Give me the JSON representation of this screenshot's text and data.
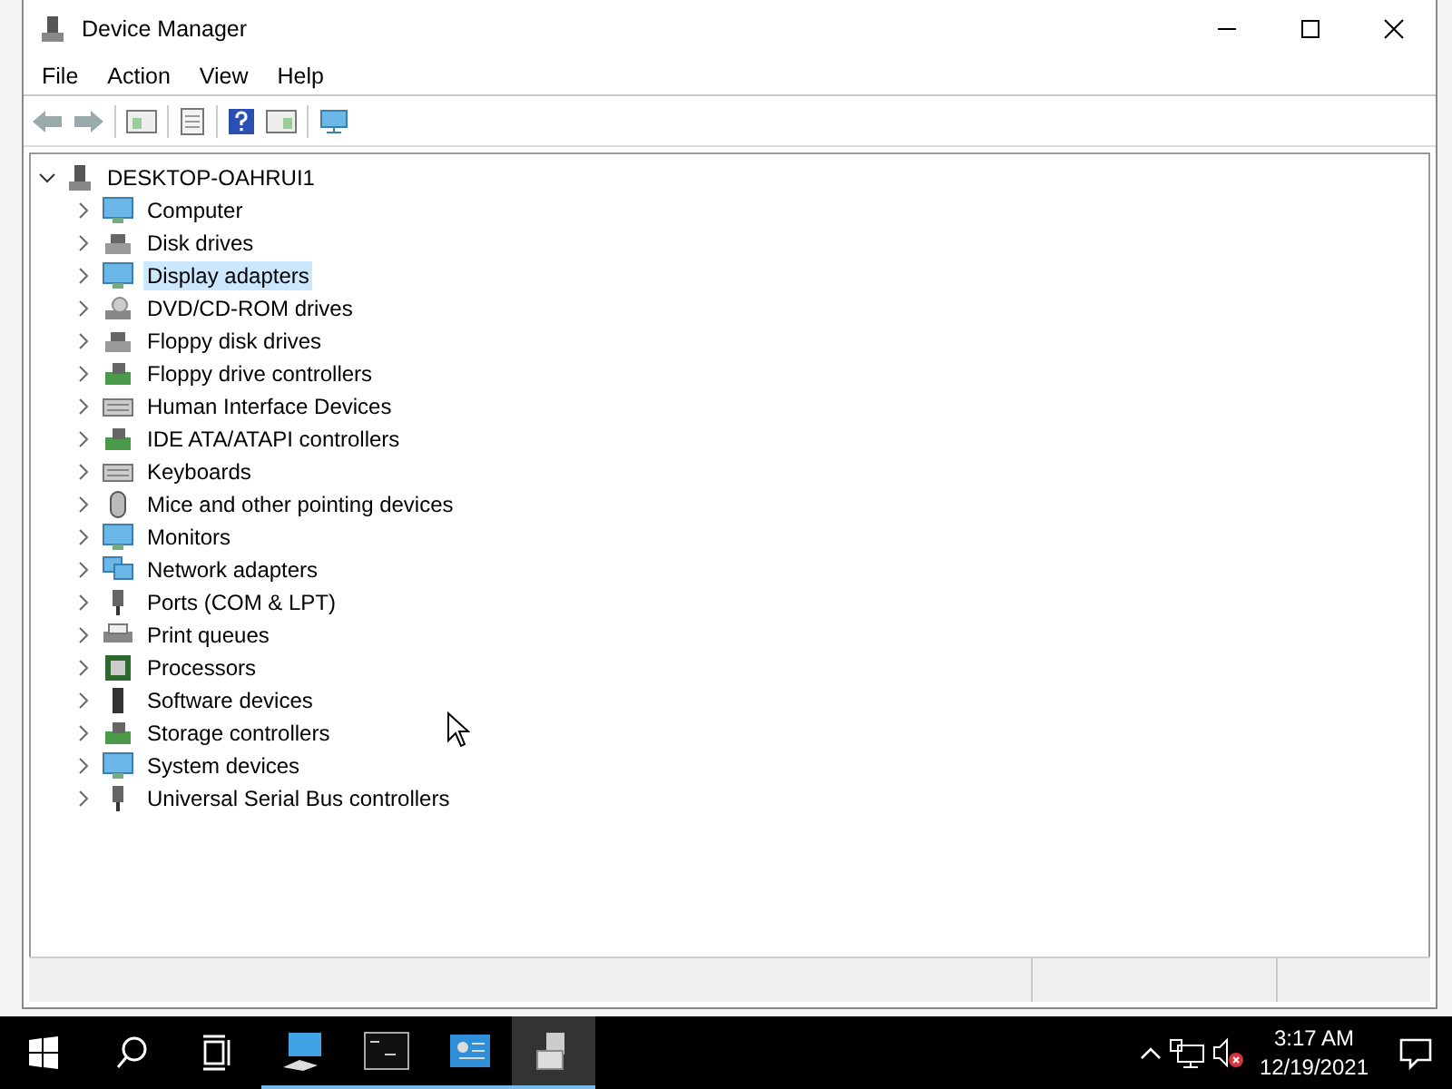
{
  "window": {
    "title": "Device Manager"
  },
  "menu": [
    "File",
    "Action",
    "View",
    "Help"
  ],
  "tree": {
    "label": "DESKTOP-OAHRUI1",
    "expanded": true,
    "selected": false,
    "children": [
      {
        "label": "Computer",
        "expanded": false,
        "selected": false
      },
      {
        "label": "Disk drives",
        "expanded": false,
        "selected": false
      },
      {
        "label": "Display adapters",
        "expanded": false,
        "selected": true
      },
      {
        "label": "DVD/CD-ROM drives",
        "expanded": false,
        "selected": false
      },
      {
        "label": "Floppy disk drives",
        "expanded": false,
        "selected": false
      },
      {
        "label": "Floppy drive controllers",
        "expanded": false,
        "selected": false
      },
      {
        "label": "Human Interface Devices",
        "expanded": false,
        "selected": false
      },
      {
        "label": "IDE ATA/ATAPI controllers",
        "expanded": false,
        "selected": false
      },
      {
        "label": "Keyboards",
        "expanded": false,
        "selected": false
      },
      {
        "label": "Mice and other pointing devices",
        "expanded": false,
        "selected": false
      },
      {
        "label": "Monitors",
        "expanded": false,
        "selected": false
      },
      {
        "label": "Network adapters",
        "expanded": false,
        "selected": false
      },
      {
        "label": "Ports (COM & LPT)",
        "expanded": false,
        "selected": false
      },
      {
        "label": "Print queues",
        "expanded": false,
        "selected": false
      },
      {
        "label": "Processors",
        "expanded": false,
        "selected": false
      },
      {
        "label": "Software devices",
        "expanded": false,
        "selected": false
      },
      {
        "label": "Storage controllers",
        "expanded": false,
        "selected": false
      },
      {
        "label": "System devices",
        "expanded": false,
        "selected": false
      },
      {
        "label": "Universal Serial Bus controllers",
        "expanded": false,
        "selected": false
      }
    ]
  },
  "taskbar": {
    "apps": [
      {
        "selected": false
      },
      {
        "selected": false
      },
      {
        "selected": false
      },
      {
        "selected": true
      }
    ]
  },
  "tray": {
    "time": "3:17 AM",
    "date": "12/19/2021"
  }
}
